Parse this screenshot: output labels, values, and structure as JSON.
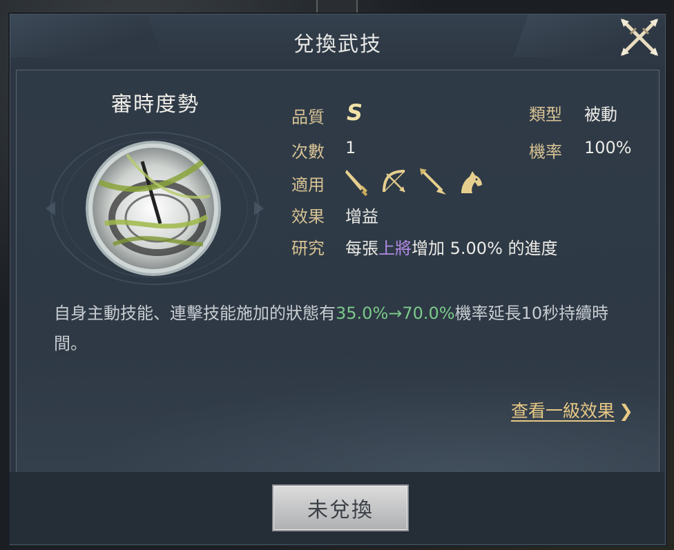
{
  "dialog": {
    "title": "兌換武技",
    "close_icon": "crossed-swords-close-icon"
  },
  "skill": {
    "name": "審時度勢",
    "icon": "sundial-wind-skill-icon"
  },
  "properties": {
    "quality_label": "品質",
    "quality_value": "S",
    "count_label": "次數",
    "count_value": "1",
    "applicable_label": "適用",
    "applicable_icons": [
      "sword-icon",
      "bow-icon",
      "spear-icon",
      "horse-icon"
    ],
    "effect_label": "效果",
    "effect_value": "增益",
    "research_label": "研究",
    "research_prefix": "每張",
    "research_highlight": "上將",
    "research_suffix": "增加 5.00% 的進度",
    "type_label": "類型",
    "type_value": "被動",
    "rate_label": "機率",
    "rate_value": "100%"
  },
  "description": {
    "prefix": "自身主動技能、連擊技能施加的狀態有",
    "highlight": "35.0%→70.0%",
    "suffix": "機率延長10秒持續時間。"
  },
  "links": {
    "view_level1": "查看一級效果",
    "chevron_icon": "chevron-right-icon"
  },
  "footer": {
    "redeem_button": "未兌換"
  },
  "colors": {
    "label_gold": "#d7c394",
    "highlight_green": "#7cc98b",
    "highlight_purple": "#b38be6",
    "panel_bg": "#2c3642"
  }
}
